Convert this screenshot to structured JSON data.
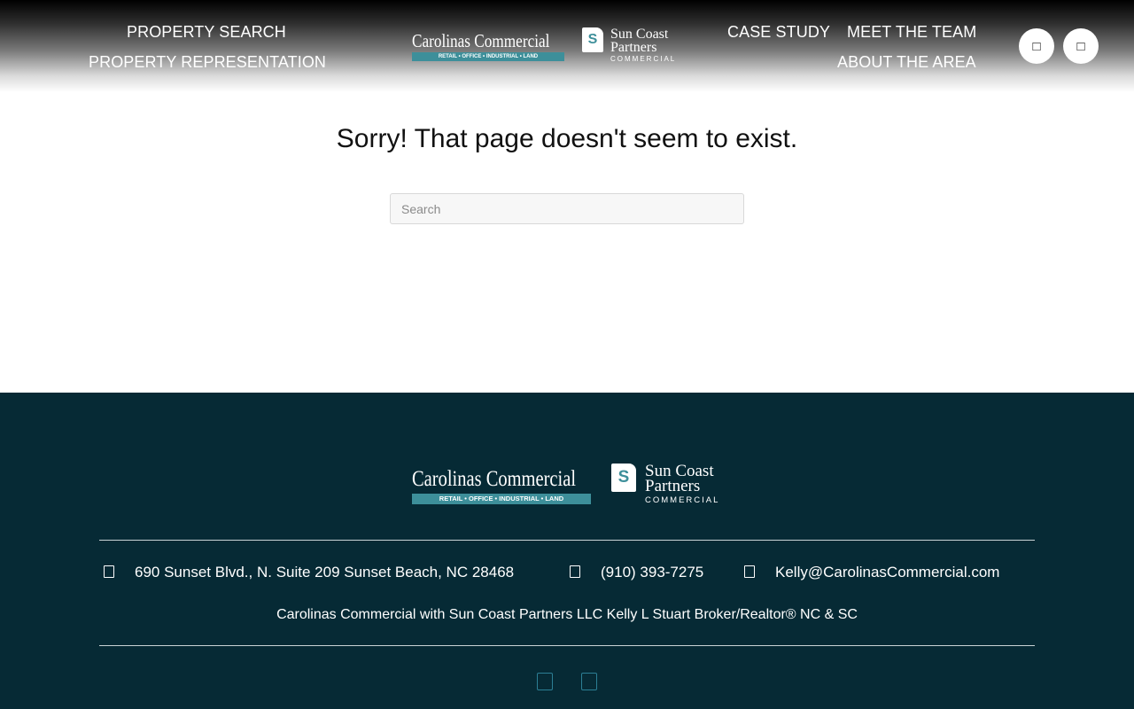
{
  "header": {
    "nav_left": [
      "PROPERTY SEARCH",
      "PROPERTY REPRESENTATION"
    ],
    "nav_right": [
      "CASE STUDY",
      "MEET THE TEAM",
      "ABOUT THE AREA"
    ],
    "icon_buttons": [
      "search-icon",
      "menu-icon"
    ]
  },
  "logos": {
    "carolinas_commercial": {
      "name": "Carolinas Commercial",
      "tagline": "RETAIL • OFFICE • INDUSTRIAL • LAND"
    },
    "sun_coast": {
      "mark": "S",
      "line1": "Sun Coast",
      "line2": "Partners",
      "line3": "COMMERCIAL"
    }
  },
  "main": {
    "title": "Sorry! That page doesn't seem to exist.",
    "search_placeholder": "Search"
  },
  "footer": {
    "address": "690 Sunset Blvd., N. Suite 209 Sunset Beach, NC 28468",
    "phone": "(910) 393-7275",
    "email": "Kelly@CarolinasCommercial.com",
    "company_line": "Carolinas Commercial with Sun Coast Partners LLC Kelly L Stuart Broker/Realtor® NC & SC",
    "social_icons": [
      "facebook-icon",
      "linkedin-icon"
    ]
  },
  "colors": {
    "header_top": "#000000",
    "footer_bg": "#062a35",
    "accent_teal": "#3d8f9a",
    "social_icon": "#2c7f95"
  }
}
